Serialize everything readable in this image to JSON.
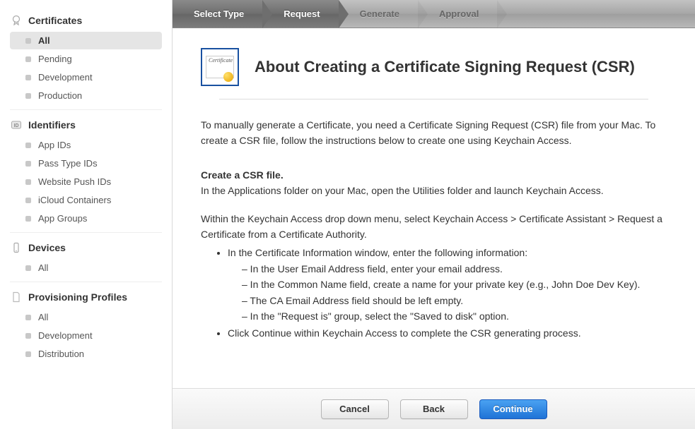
{
  "sidebar": {
    "sections": [
      {
        "title": "Certificates",
        "icon": "badge-icon",
        "items": [
          {
            "label": "All",
            "selected": true
          },
          {
            "label": "Pending",
            "selected": false
          },
          {
            "label": "Development",
            "selected": false
          },
          {
            "label": "Production",
            "selected": false
          }
        ]
      },
      {
        "title": "Identifiers",
        "icon": "id-icon",
        "items": [
          {
            "label": "App IDs",
            "selected": false
          },
          {
            "label": "Pass Type IDs",
            "selected": false
          },
          {
            "label": "Website Push IDs",
            "selected": false
          },
          {
            "label": "iCloud Containers",
            "selected": false
          },
          {
            "label": "App Groups",
            "selected": false
          }
        ]
      },
      {
        "title": "Devices",
        "icon": "device-icon",
        "items": [
          {
            "label": "All",
            "selected": false
          }
        ]
      },
      {
        "title": "Provisioning Profiles",
        "icon": "profile-icon",
        "items": [
          {
            "label": "All",
            "selected": false
          },
          {
            "label": "Development",
            "selected": false
          },
          {
            "label": "Distribution",
            "selected": false
          }
        ]
      }
    ]
  },
  "wizard": {
    "steps": [
      {
        "label": "Select Type",
        "state": "active"
      },
      {
        "label": "Request",
        "state": "active"
      },
      {
        "label": "Generate",
        "state": "inactive"
      },
      {
        "label": "Approval",
        "state": "inactive"
      }
    ]
  },
  "page": {
    "title": "About Creating a Certificate Signing Request (CSR)",
    "icon_text": "Certificate",
    "intro": "To manually generate a Certificate, you need a Certificate Signing Request (CSR) file from your Mac. To create a CSR file, follow the instructions below to create one using Keychain Access.",
    "subhead": "Create a CSR file.",
    "instr1": "In the Applications folder on your Mac, open the Utilities folder and launch Keychain Access.",
    "instr2": "Within the Keychain Access drop down menu, select Keychain Access > Certificate Assistant > Request a Certificate from a Certificate Authority.",
    "bullet1": "In the Certificate Information window, enter the following information:",
    "dash1": "– In the User Email Address field, enter your email address.",
    "dash2": "– In the Common Name field, create a name for your private key (e.g., John Doe Dev Key).",
    "dash3": "– The CA Email Address field should be left empty.",
    "dash4": "– In the \"Request is\" group, select the \"Saved to disk\" option.",
    "bullet2": "Click Continue within Keychain Access to complete the CSR generating process."
  },
  "footer": {
    "cancel": "Cancel",
    "back": "Back",
    "continue": "Continue"
  }
}
